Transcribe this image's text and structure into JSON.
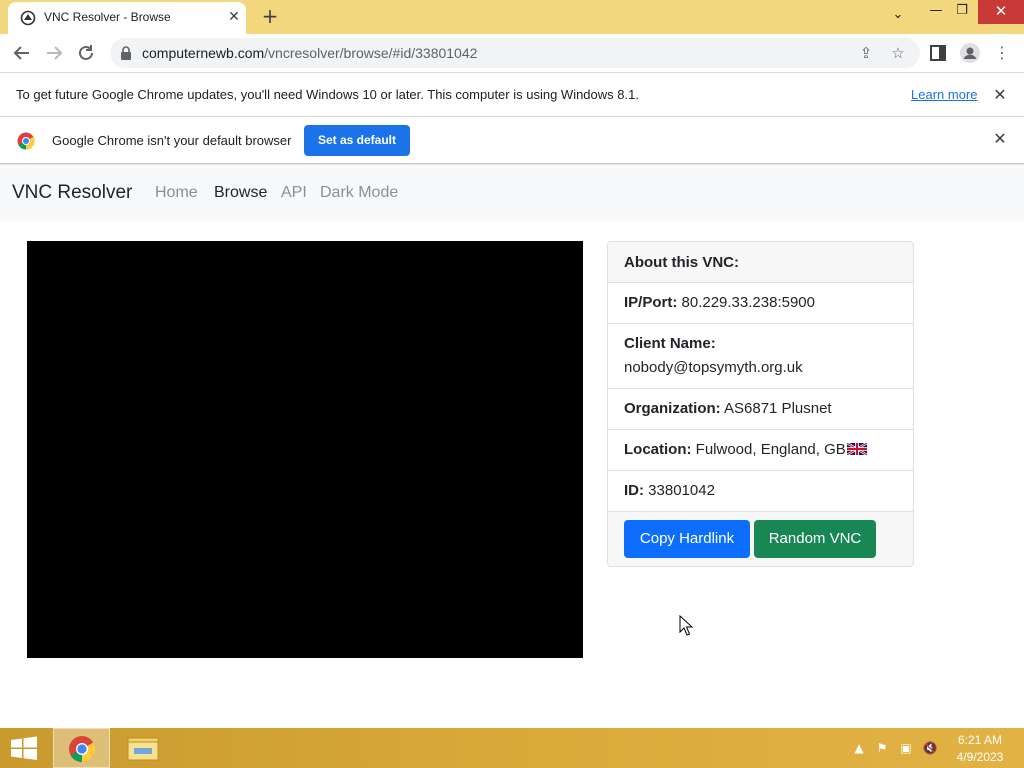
{
  "browser": {
    "tab_title": "VNC Resolver - Browse",
    "url_host": "computernewb.com",
    "url_path": "/vncresolver/browse/#id/33801042"
  },
  "infobar_update": {
    "text": "To get future Google Chrome updates, you'll need Windows 10 or later. This computer is using Windows 8.1.",
    "link": "Learn more"
  },
  "infobar_default": {
    "text": "Google Chrome isn't your default browser",
    "button": "Set as default"
  },
  "navbar": {
    "brand": "VNC Resolver",
    "links": [
      "Home",
      "Browse",
      "API",
      "Dark Mode"
    ],
    "active": "Browse"
  },
  "details": {
    "title": "About this VNC:",
    "ip_label": "IP/Port:",
    "ip_value": "80.229.33.238:5900",
    "client_label": "Client Name:",
    "client_value": "nobody@topsymyth.org.uk",
    "org_label": "Organization:",
    "org_value": "AS6871 Plusnet",
    "location_label": "Location:",
    "location_value": "Fulwood, England, GB",
    "id_label": "ID:",
    "id_value": "33801042"
  },
  "buttons": {
    "copy": "Copy Hardlink",
    "random": "Random VNC"
  },
  "taskbar": {
    "time": "6:21 AM",
    "date": "4/9/2023"
  },
  "colors": {
    "primary": "#0d6efd",
    "success": "#198754",
    "chrome_frame": "#f3d77f",
    "taskbar": "#d9a93a"
  }
}
